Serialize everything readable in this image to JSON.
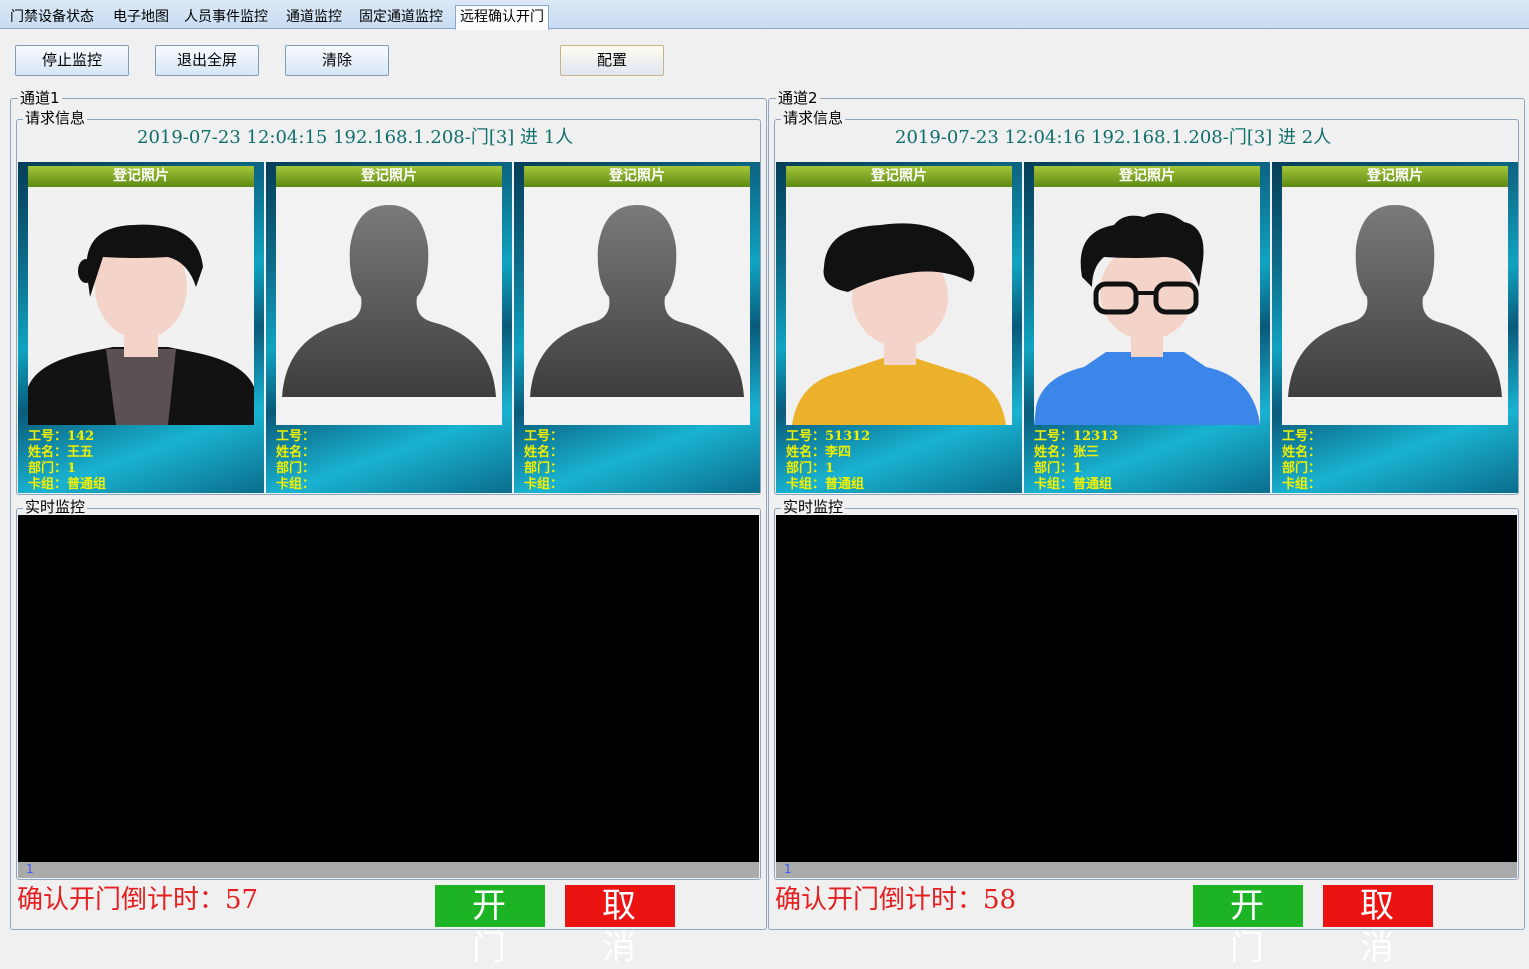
{
  "tabs": [
    "门禁设备状态",
    "电子地图",
    "人员事件监控",
    "通道监控",
    "固定通道监控",
    "远程确认开门"
  ],
  "toolbar": {
    "stop": "停止监控",
    "exit_fullscreen": "退出全屏",
    "clear": "清除",
    "config": "配置"
  },
  "channels": [
    {
      "title": "通道1",
      "request_label": "请求信息",
      "request_text": "2019-07-23  12:04:15  192.168.1.208-门[3]  进  1人",
      "card_header": "登记照片",
      "persons": [
        {
          "id": "工号：142",
          "name": "姓名：王五",
          "dept": "部门：1",
          "group": "卡组：普通组",
          "avatar": "man-suit-avatar"
        },
        {
          "id": "工号：",
          "name": "姓名：",
          "dept": "部门：",
          "group": "卡组：",
          "avatar": "placeholder-silhouette"
        },
        {
          "id": "工号：",
          "name": "姓名：",
          "dept": "部门：",
          "group": "卡组：",
          "avatar": "placeholder-silhouette"
        }
      ],
      "monitor_label": "实时监控",
      "monitor_index": "1",
      "countdown": "确认开门倒计时：57",
      "open": "开门",
      "cancel": "取消"
    },
    {
      "title": "通道2",
      "request_label": "请求信息",
      "request_text": "2019-07-23  12:04:16  192.168.1.208-门[3]  进  2人",
      "card_header": "登记照片",
      "persons": [
        {
          "id": "工号：51312",
          "name": "姓名：李四",
          "dept": "部门：1",
          "group": "卡组：普通组",
          "avatar": "yellow-shirt-avatar"
        },
        {
          "id": "工号：12313",
          "name": "姓名：张三",
          "dept": "部门：1",
          "group": "卡组：普通组",
          "avatar": "glasses-blue-shirt-avatar"
        },
        {
          "id": "工号：",
          "name": "姓名：",
          "dept": "部门：",
          "group": "卡组：",
          "avatar": "placeholder-silhouette"
        }
      ],
      "monitor_label": "实时监控",
      "monitor_index": "1",
      "countdown": "确认开门倒计时：58",
      "open": "开门",
      "cancel": "取消"
    }
  ],
  "colors": {
    "request_text": "#0f6e6c",
    "info_text": "#f1f000",
    "countdown": "#e51f1f",
    "open_button": "#1cb424",
    "cancel_button": "#ec1313"
  }
}
